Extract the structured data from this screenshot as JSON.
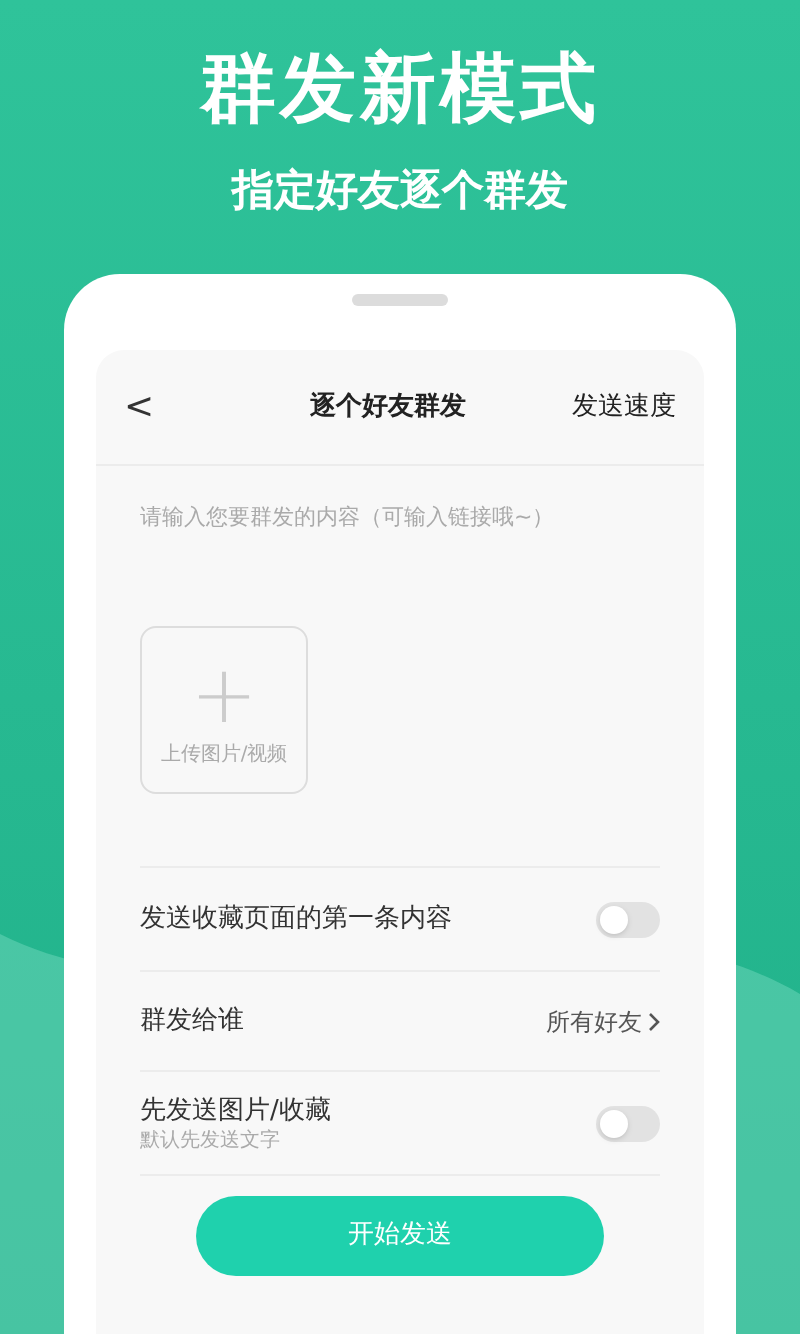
{
  "banner": {
    "title": "群发新模式",
    "subtitle": "指定好友逐个群发"
  },
  "screen": {
    "back": "<",
    "title": "逐个好友群发",
    "action": "发送速度",
    "message": {
      "placeholder": "请输入您要群发的内容（可输入链接哦~）"
    },
    "upload": {
      "icon": "+",
      "label": "上传图片/视频"
    },
    "settings": [
      {
        "kind": "toggle",
        "label": "发送收藏页面的第一条内容",
        "on": false
      },
      {
        "kind": "link",
        "label": "群发给谁",
        "value": "所有好友"
      },
      {
        "kind": "toggle",
        "label": "先发送图片/收藏",
        "hint": "默认先发送文字",
        "on": false
      }
    ],
    "start_button": "开始发送"
  }
}
